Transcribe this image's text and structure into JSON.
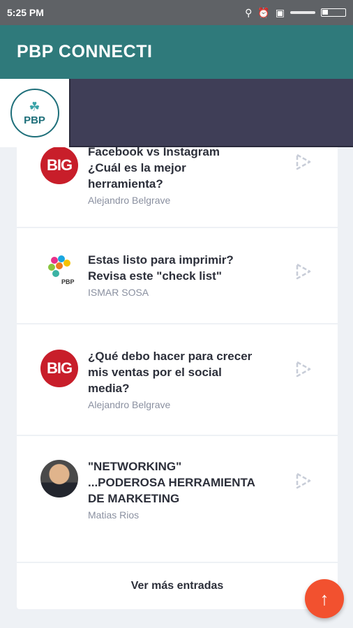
{
  "status_bar": {
    "time": "5:25 PM"
  },
  "app_bar": {
    "title": "PBP CONNECTI"
  },
  "banner": {
    "logo_text": "PBP"
  },
  "posts": [
    {
      "title": "Facebook vs Instagram ¿Cuál es la mejor herramienta?",
      "author": "Alejandro Belgrave",
      "avatar": "big-logo",
      "avatar_text": "BIG"
    },
    {
      "title": "Estas listo para imprimir? Revisa este \"check list\"",
      "author": "ISMAR SOSA",
      "avatar": "colorful-logo",
      "avatar_text": "PBP"
    },
    {
      "title": "¿Qué debo hacer para crecer mis ventas por el social media?",
      "author": "Alejandro Belgrave",
      "avatar": "big-logo",
      "avatar_text": "BIG"
    },
    {
      "title": "\"NETWORKING\" ...PODEROSA HERRAMIENTA DE MARKETING",
      "author": "Matias Rios",
      "avatar": "person-photo"
    }
  ],
  "more_button": {
    "label": "Ver más entradas"
  },
  "colors": {
    "app_bar": "#2f7a7b",
    "banner_dark": "#3f3e57",
    "fab": "#f2512f",
    "accent_red": "#c81e2a"
  }
}
